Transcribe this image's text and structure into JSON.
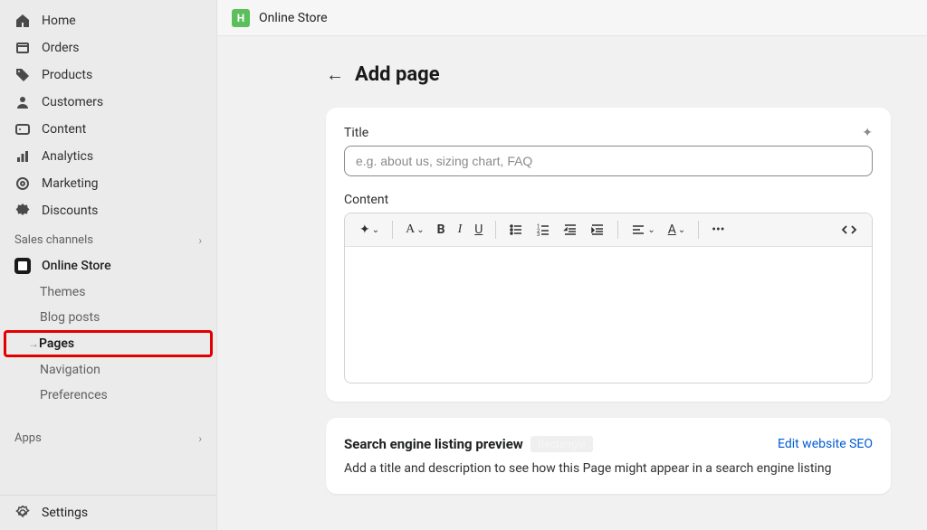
{
  "sidebar": {
    "nav": [
      {
        "label": "Home"
      },
      {
        "label": "Orders"
      },
      {
        "label": "Products"
      },
      {
        "label": "Customers"
      },
      {
        "label": "Content"
      },
      {
        "label": "Analytics"
      },
      {
        "label": "Marketing"
      },
      {
        "label": "Discounts"
      }
    ],
    "sales_channels_label": "Sales channels",
    "store": {
      "label": "Online Store"
    },
    "sub": [
      {
        "label": "Themes"
      },
      {
        "label": "Blog posts"
      },
      {
        "label": "Pages"
      },
      {
        "label": "Navigation"
      },
      {
        "label": "Preferences"
      }
    ],
    "apps_label": "Apps",
    "settings_label": "Settings"
  },
  "topbar": {
    "title": "Online Store"
  },
  "page": {
    "title": "Add page",
    "title_field_label": "Title",
    "title_placeholder": "e.g. about us, sizing chart, FAQ",
    "content_label": "Content",
    "seo_heading": "Search engine listing preview",
    "seo_badge": "Rectangle",
    "seo_link": "Edit website SEO",
    "seo_desc": "Add a title and description to see how this Page might appear in a search engine listing"
  },
  "toolbar": {
    "bold": "B",
    "italic": "I",
    "underline": "U",
    "font": "A"
  }
}
